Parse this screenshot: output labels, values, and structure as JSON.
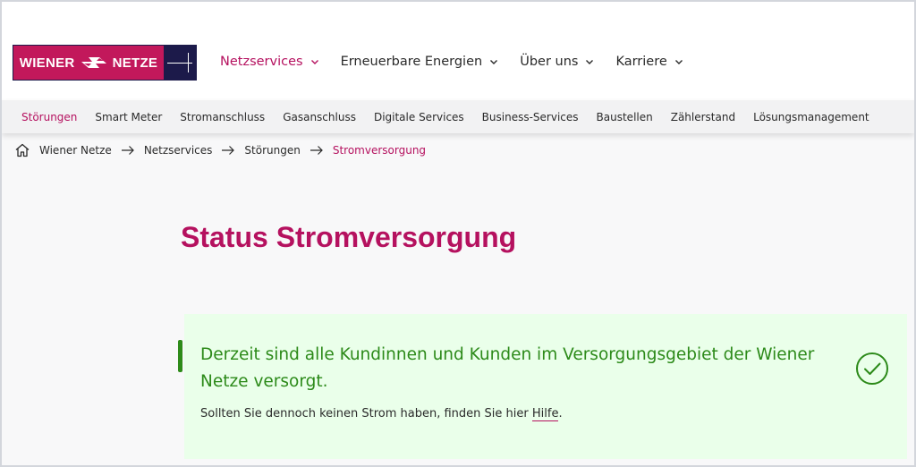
{
  "logo": {
    "text_left": "WIENER",
    "text_right": "NETZE"
  },
  "main_nav": [
    {
      "label": "Netzservices",
      "active": true
    },
    {
      "label": "Erneuerbare Energien",
      "active": false
    },
    {
      "label": "Über uns",
      "active": false
    },
    {
      "label": "Karriere",
      "active": false
    }
  ],
  "sub_nav": [
    {
      "label": "Störungen",
      "active": true
    },
    {
      "label": "Smart Meter"
    },
    {
      "label": "Stromanschluss"
    },
    {
      "label": "Gasanschluss"
    },
    {
      "label": "Digitale Services"
    },
    {
      "label": "Business-Services"
    },
    {
      "label": "Baustellen"
    },
    {
      "label": "Zählerstand"
    },
    {
      "label": "Lösungsmanagement"
    }
  ],
  "breadcrumb": [
    "Wiener Netze",
    "Netzservices",
    "Störungen",
    "Stromversorgung"
  ],
  "page_title": "Status Stromversorgung",
  "status": {
    "headline": "Derzeit sind alle Kundinnen und Kunden im Versorgungsgebiet der Wiener Netze versorgt.",
    "sub_prefix": "Sollten Sie dennoch keinen Strom haben, finden Sie hier ",
    "link_label": "Hilfe",
    "sub_suffix": "."
  },
  "colors": {
    "brand": "#b5115f",
    "logo_navy": "#1c1a4a",
    "success_text": "#2c8a19",
    "success_bg": "#eaffea"
  }
}
